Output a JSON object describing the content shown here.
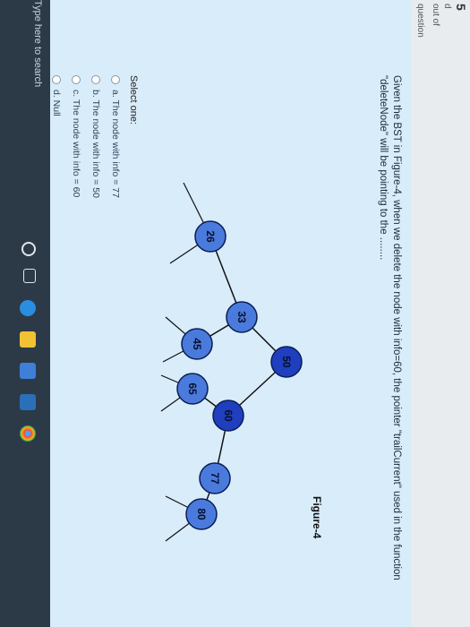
{
  "sidebar": {
    "question_number": "5",
    "status_label": "d",
    "mark_label": "out of",
    "flag_label": "question"
  },
  "question": {
    "text": "Given the BST in Figure-4, when we delete the node with info=60, the pointer \"trailCurrent\" used in the function \"deleteNode\" will be pointing to the ........"
  },
  "figure": {
    "caption": "Figure-4",
    "nodes": [
      {
        "id": "n50",
        "label": "50",
        "shade": "dark"
      },
      {
        "id": "n33",
        "label": "33",
        "shade": "light"
      },
      {
        "id": "n26",
        "label": "26",
        "shade": "light"
      },
      {
        "id": "n45",
        "label": "45",
        "shade": "light"
      },
      {
        "id": "n60",
        "label": "60",
        "shade": "dark"
      },
      {
        "id": "n65",
        "label": "65",
        "shade": "light"
      },
      {
        "id": "n77",
        "label": "77",
        "shade": "light"
      },
      {
        "id": "n80",
        "label": "80",
        "shade": "light"
      }
    ],
    "colors": {
      "dark": "#1f3fbf",
      "light": "#4a7bdc",
      "edge": "#111111"
    }
  },
  "answers": {
    "prompt": "Select one:",
    "options": [
      {
        "label": "a. The node with info = 77"
      },
      {
        "label": "b. The node with info = 50"
      },
      {
        "label": "c. The node with info = 60"
      },
      {
        "label": "d. Null"
      }
    ]
  },
  "taskbar": {
    "search_placeholder": "Type here to search",
    "icons": [
      "cortana-icon",
      "task-view-icon",
      "edge-icon",
      "file-explorer-icon",
      "store-icon",
      "mail-icon",
      "chrome-icon"
    ]
  }
}
